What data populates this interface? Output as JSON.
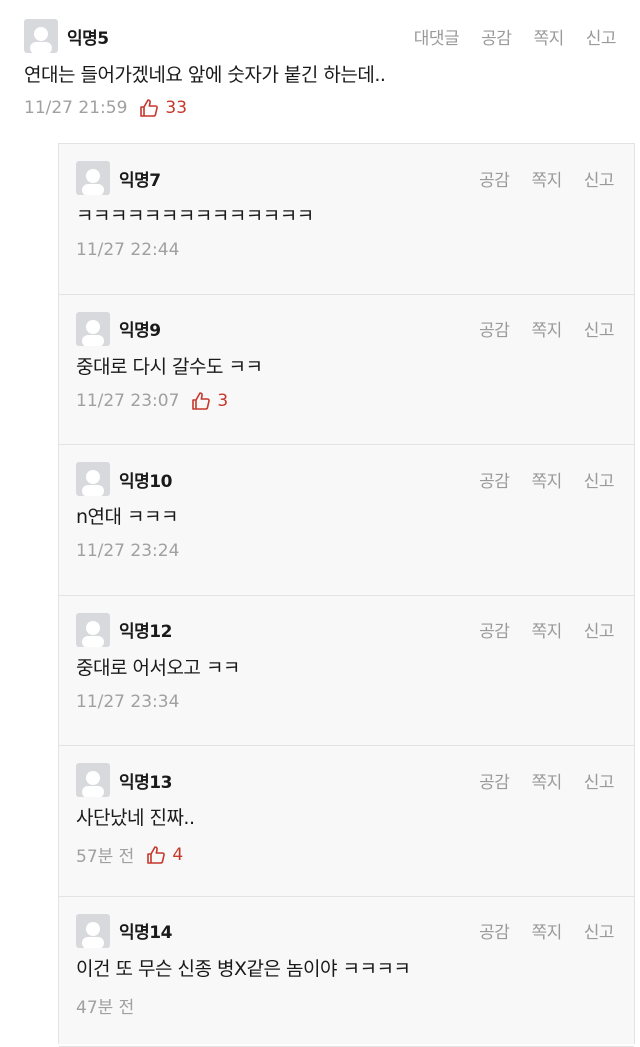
{
  "top_comment": {
    "nickname": "익명5",
    "actions": [
      "대댓글",
      "공감",
      "쪽지",
      "신고"
    ],
    "text": "연대는 들어가겠네요 앞에 숫자가 붙긴 하는데..",
    "time": "11/27 21:59",
    "likes": "33"
  },
  "replies": [
    {
      "nickname": "익명7",
      "text": "ㅋㅋㅋㅋㅋㅋㅋㅋㅋㅋㅋㅋㅋㅋ",
      "time": "11/27 22:44",
      "likes": ""
    },
    {
      "nickname": "익명9",
      "text": "중대로 다시 갈수도 ㅋㅋ",
      "time": "11/27 23:07",
      "likes": "3"
    },
    {
      "nickname": "익명10",
      "text": "n연대 ㅋㅋㅋ",
      "time": "11/27 23:24",
      "likes": ""
    },
    {
      "nickname": "익명12",
      "text": "중대로 어서오고 ㅋㅋ",
      "time": "11/27 23:34",
      "likes": ""
    },
    {
      "nickname": "익명13",
      "text": "사단났네 진짜..",
      "time": "57분 전",
      "likes": "4"
    },
    {
      "nickname": "익명14",
      "text": "이건 또 무슨 신종 병X같은 놈이야 ㅋㅋㅋㅋ",
      "time": "47분 전",
      "likes": ""
    }
  ],
  "reply_actions": [
    "공감",
    "쪽지",
    "신고"
  ],
  "colors": {
    "like": "#c6372c",
    "muted": "#9a9a9a",
    "reply_bg": "#f8f8f8"
  },
  "icons": {
    "avatar": "default-avatar-icon",
    "like": "thumbs-up-icon"
  }
}
